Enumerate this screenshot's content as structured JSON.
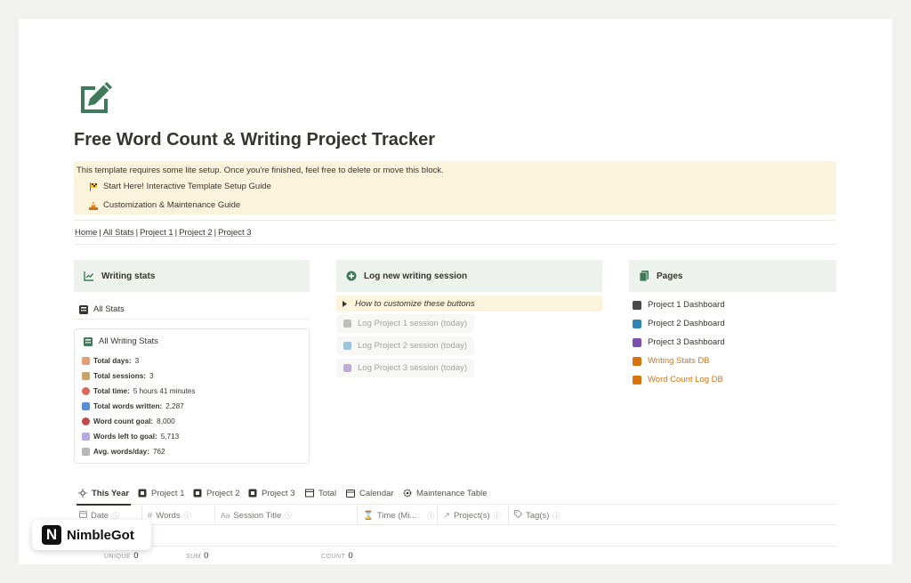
{
  "title": "Free Word Count & Writing Project Tracker",
  "colors": {
    "accent_green": "#3f7a5a",
    "callout_bg": "#fbf3db",
    "header_bg": "#edf3ec",
    "db_link": "#d9730d"
  },
  "callout": {
    "note": "This template requires some lite setup. Once you're finished, feel free to delete or move this block.",
    "links": [
      {
        "icon": "checkered-flag-icon",
        "label": "Start Here! Interactive Template Setup Guide"
      },
      {
        "icon": "construction-icon",
        "label": "Customization & Maintenance Guide"
      }
    ]
  },
  "nav": {
    "items": [
      "Home",
      "All Stats",
      "Project 1",
      "Project 2",
      "Project 3"
    ],
    "separator": "|"
  },
  "writing_stats": {
    "header": "Writing stats",
    "all_stats_link": "All Stats",
    "card_title": "All Writing Stats",
    "rows": [
      {
        "icon": "calendar-icon",
        "label": "Total days:",
        "value": "3",
        "color": "#e0a07a"
      },
      {
        "icon": "people-icon",
        "label": "Total sessions:",
        "value": "3",
        "color": "#c9a26c"
      },
      {
        "icon": "clock-icon",
        "label": "Total time:",
        "value": "5 hours 41 minutes",
        "color": "#d96a5a"
      },
      {
        "icon": "numbers-icon",
        "label": "Total words written:",
        "value": "2,287",
        "color": "#5a8fd6"
      },
      {
        "icon": "target-icon",
        "label": "Word count goal:",
        "value": "8,000",
        "color": "#c24a4a"
      },
      {
        "icon": "chart-up-icon",
        "label": "Words left to goal:",
        "value": "5,713",
        "color": "#b7a9e0"
      },
      {
        "icon": "scale-icon",
        "label": "Avg. words/day:",
        "value": "762",
        "color": "#b8b8b8"
      }
    ]
  },
  "log_session": {
    "header": "Log new writing session",
    "toggle_label": "How to customize these buttons",
    "buttons": [
      {
        "label": "Log Project 1 session (today)",
        "color": "#787774"
      },
      {
        "label": "Log Project 2 session (today)",
        "color": "#2f86b5"
      },
      {
        "label": "Log Project 3 session (today)",
        "color": "#7b4fb0"
      }
    ]
  },
  "pages": {
    "header": "Pages",
    "items": [
      {
        "label": "Project 1 Dashboard",
        "color": "#4a4a48",
        "db": false
      },
      {
        "label": "Project 2 Dashboard",
        "color": "#2f86b5",
        "db": false
      },
      {
        "label": "Project 3 Dashboard",
        "color": "#7b4fb0",
        "db": false
      },
      {
        "label": "Writing Stats DB",
        "color": "#d9730d",
        "db": true
      },
      {
        "label": "Word Count Log DB",
        "color": "#d9730d",
        "db": true
      }
    ]
  },
  "tabs": [
    {
      "label": "This Year",
      "icon": "sun-icon",
      "active": true
    },
    {
      "label": "Project 1",
      "icon": "square-icon",
      "active": false
    },
    {
      "label": "Project 2",
      "icon": "square-icon",
      "active": false
    },
    {
      "label": "Project 3",
      "icon": "square-icon",
      "active": false
    },
    {
      "label": "Total",
      "icon": "table-icon",
      "active": false
    },
    {
      "label": "Calendar",
      "icon": "calendar-icon",
      "active": false
    },
    {
      "label": "Maintenance Table",
      "icon": "gear-icon",
      "active": false
    }
  ],
  "table": {
    "columns": [
      {
        "label": "Date",
        "icon": "calendar-icon"
      },
      {
        "label": "Words",
        "icon": "hash-icon"
      },
      {
        "label": "Session Title",
        "icon": "text-icon"
      },
      {
        "label": "Time (Mi...",
        "icon": "hourglass-icon"
      },
      {
        "label": "Project(s)",
        "icon": "relation-icon"
      },
      {
        "label": "Tag(s)",
        "icon": "tag-icon"
      }
    ],
    "footer": [
      {
        "label": "UNIQUE",
        "value": "0"
      },
      {
        "label": "SUM",
        "value": "0"
      },
      {
        "label": "COUNT",
        "value": "0"
      }
    ]
  },
  "badge": {
    "logo_letter": "N",
    "brand": "NimbleGot"
  }
}
